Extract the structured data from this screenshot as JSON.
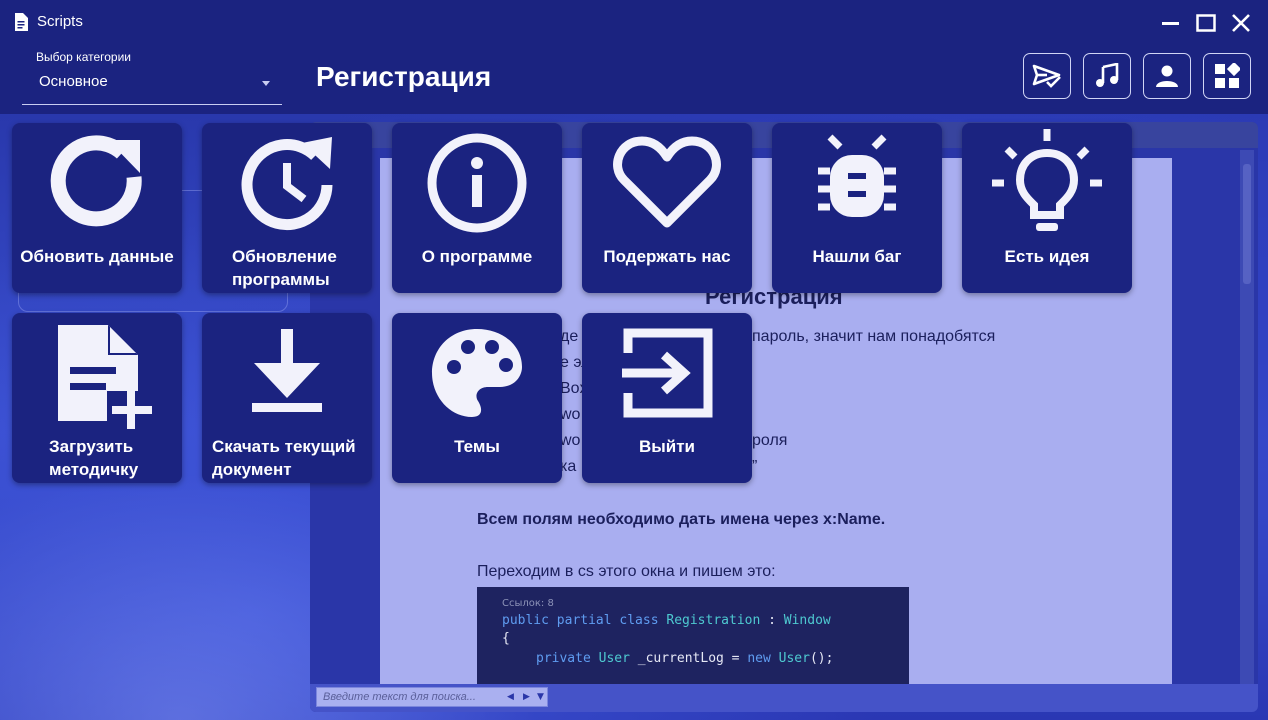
{
  "window": {
    "title": "Scripts"
  },
  "header": {
    "category_label": "Выбор категории",
    "category_value": "Основное",
    "page_title": "Регистрация",
    "tools": [
      "send-check-icon",
      "music-icon",
      "user-icon",
      "widgets-icon"
    ]
  },
  "tiles": [
    {
      "label": "Обновить данные",
      "icon": "refresh-icon"
    },
    {
      "label": "Обновление программы",
      "icon": "history-icon"
    },
    {
      "label": "О программе",
      "icon": "info-icon"
    },
    {
      "label": "Подержать нас",
      "icon": "heart-icon"
    },
    {
      "label": "Нашли баг",
      "icon": "bug-icon"
    },
    {
      "label": "Есть идея",
      "icon": "lightbulb-icon"
    },
    {
      "label": "Загрузить методичку",
      "icon": "file-add-icon"
    },
    {
      "label": "Скачать текущий документ",
      "icon": "download-icon"
    },
    {
      "label": "Темы",
      "icon": "palette-icon"
    },
    {
      "label": "Выйти",
      "icon": "exit-icon"
    }
  ],
  "document": {
    "heading": "Регистрация",
    "lines": [
      "де",
      "пароль, значит нам понадобятся",
      "е эл",
      "Box",
      "wo",
      "wo",
      "роля",
      "ка",
      "”"
    ],
    "bold_line": "Всем полям необходимо дать имена через x:Name.",
    "line_cs": "Переходим в cs этого окна и пишем это:",
    "code": {
      "refs": "Ссылок: 8",
      "line1_kw": "public partial class",
      "line1_type": "Registration",
      "line1_rest": " : ",
      "line1_type2": "Window",
      "line2": "{",
      "line3_kw": "private",
      "line3_type": "User",
      "line3_name": " _currentLog = ",
      "line3_kw2": "new",
      "line3_type2": "User",
      "line3_end": "();"
    }
  },
  "search": {
    "placeholder": "Введите текст для поиска..."
  },
  "colors": {
    "primary": "#1b2380",
    "paper": "#a9aef0",
    "accent": "#3a4fd0"
  }
}
